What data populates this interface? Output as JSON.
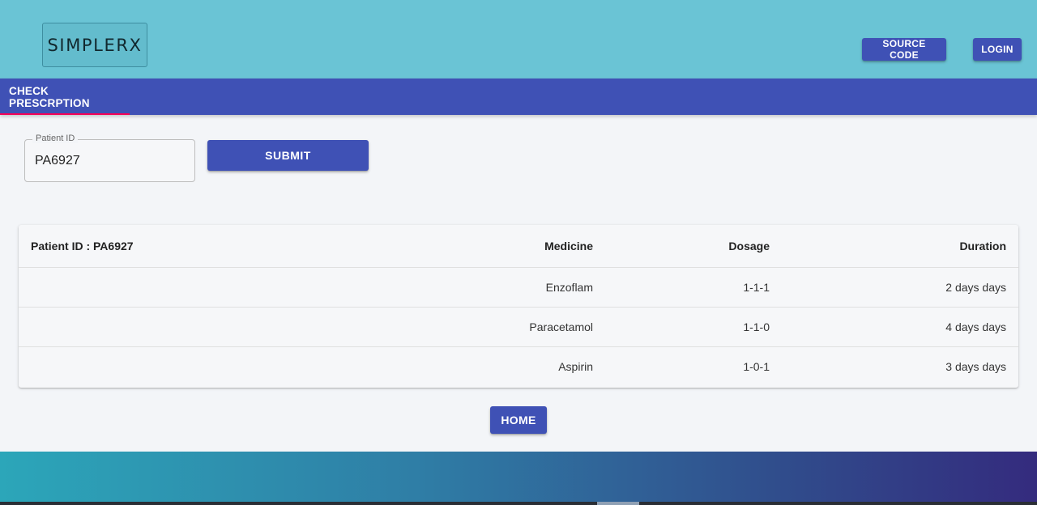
{
  "header": {
    "logo": "SIMPLERX",
    "source_code_label": "SOURCE CODE",
    "login_label": "LOGIN"
  },
  "tabs": [
    {
      "label": "CHECK PRESCRPTION",
      "active": true
    }
  ],
  "form": {
    "patient_id_label": "Patient ID",
    "patient_id_value": "PA6927",
    "submit_label": "SUBMIT"
  },
  "table": {
    "headers": [
      "Patient ID : PA6927",
      "Medicine",
      "Dosage",
      "Duration"
    ],
    "rows": [
      {
        "medicine": "Enzoflam",
        "dosage": "1-1-1",
        "duration": "2 days days"
      },
      {
        "medicine": "Paracetamol",
        "dosage": "1-1-0",
        "duration": "4 days days"
      },
      {
        "medicine": "Aspirin",
        "dosage": "1-0-1",
        "duration": "3 days days"
      }
    ]
  },
  "home_label": "HOME",
  "colors": {
    "header_bg": "#6ac4d5",
    "primary": "#3f51b5",
    "tab_indicator": "#f50057",
    "footer_gradient_start": "#2ca6b9",
    "footer_gradient_end": "#342b7e"
  }
}
